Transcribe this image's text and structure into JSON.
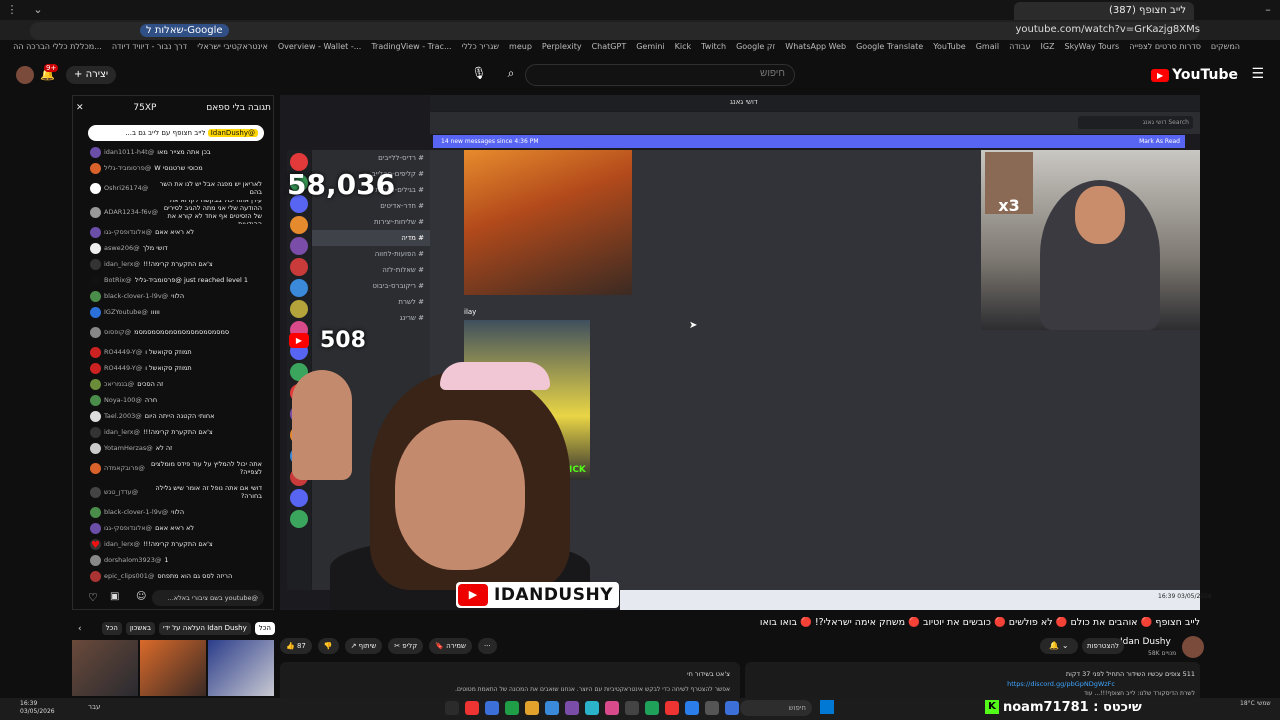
{
  "browser": {
    "active_tab_title": "לייב חצופף (387)",
    "url": "youtube.com/watch?v=GrKazjg8XMs",
    "google_button": "שאלות ל-Google",
    "bookmarks": [
      "המשקים",
      "סדרות סרטים לצפייה",
      "SkyWay Tours",
      "IGZ",
      "עבודה",
      "Gmail",
      "YouTube",
      "Google Translate",
      "WhatsApp Web",
      "Google זק",
      "Twitch",
      "Kick",
      "Gemini",
      "ChatGPT",
      "Perplexity",
      "meup",
      "שגריר כללי",
      "TradingView - Trac...",
      "Overview - Wallet -...",
      "אינטראקטיבי ישראלי",
      "דרך נבור - דיוויד דיודה",
      "מכללת כללי הברכה הה..."
    ]
  },
  "youtube": {
    "logo": "YouTube",
    "search_placeholder": "חיפוש",
    "create_label": "+ יצירה",
    "notif_count": "9+"
  },
  "chat": {
    "title": "תגובה בלי ספאם",
    "points": "75XP",
    "pinned_author": "@IdanDushy",
    "pinned_text": "לייב חצופף עם לייב גם ב...",
    "messages": [
      {
        "author": "@idan1011-h4t",
        "text": "בכן אתה מצייר מאו",
        "color": "#6b4ea8",
        "tall": false
      },
      {
        "author": "@פרסומביד-גליל",
        "text": "מכוסי שרטנוסי W",
        "color": "#d9622b",
        "tall": false
      },
      {
        "author": "@Oshri26174",
        "text": "לאריאן יש מפגה אבל יש לנו את השר בהם",
        "color": "#ffffff",
        "tall": true
      },
      {
        "author": "@ADAR1234-f6v",
        "text": "עידן אתה יכול בבקשה לקרוא את ההודעה שלי אני מתה להגיב לסירים של הזסיטים אף אחד לא קורא את ההודעות",
        "color": "#999999",
        "tall": true
      },
      {
        "author": "@אלונדופסקי-גגו",
        "text": "לא ראיא אאם",
        "color": "#6b4ea8",
        "tall": false
      },
      {
        "author": "@aswe206",
        "text": "דושי מלך",
        "color": "#eeeeee",
        "tall": false
      },
      {
        "author": "@idan_lerx",
        "text": "צ'אם התקערת קרימה!!!",
        "color": "#333333",
        "tall": false
      },
      {
        "author": "@BotRix",
        "text": "just reached level 1 @פרסומביד-גליל",
        "color": "#111111",
        "tall": false
      },
      {
        "author": "@black-clover-1-l9v",
        "text": "הלווי",
        "color": "#4a8d4a",
        "tall": false
      },
      {
        "author": "@IGZYoutube",
        "text": "ווווו",
        "color": "#2b6fd9",
        "tall": false
      },
      {
        "author": "@קופסוס",
        "text": "סמסמסמסמסמסמסמסמסמסמסמ",
        "color": "#888888",
        "tall": true
      },
      {
        "author": "@RO4449-Y",
        "text": "תמוזק סקואשל ו",
        "color": "#cc2222",
        "tall": false
      },
      {
        "author": "@RO4449-Y",
        "text": "תמוזק סקואשל ו",
        "color": "#cc2222",
        "tall": false
      },
      {
        "author": "@בנמריאכ",
        "text": "זה הסכים",
        "color": "#6b8d3a",
        "tall": false
      },
      {
        "author": "@Noya-100",
        "text": "חרה",
        "color": "#4a8d4a",
        "tall": false
      },
      {
        "author": "@Tael.2003",
        "text": "אחותי הקטנה הייתה היום",
        "color": "#dddddd",
        "tall": false
      },
      {
        "author": "@idan_lerx",
        "text": "צ'אם התקערת קרימה!!!",
        "color": "#333333",
        "tall": false
      },
      {
        "author": "@YotamHerzas",
        "text": "זה לא",
        "color": "#cccccc",
        "tall": false
      },
      {
        "author": "@פרובקאמדה",
        "text": "אתה יכול להמליץ על עוד פידס מומלצים לצפייה?",
        "color": "#d9622b",
        "tall": true
      },
      {
        "author": "@עדדן_טנש",
        "text": "דושי אם אתה נופל זה אומר שיש גלילה בחורה?",
        "color": "#444444",
        "tall": true
      },
      {
        "author": "@black-clover-1-l9v",
        "text": "הלווי",
        "color": "#4a8d4a",
        "tall": false
      },
      {
        "author": "@אלונדופסקי-גגו",
        "text": "לא ראיא אאם",
        "color": "#6b4ea8",
        "tall": false
      },
      {
        "author": "@idan_lerx",
        "text": "צ'אם התקערת קרימה!!!",
        "color": "#333333",
        "tall": false
      },
      {
        "author": "@dorshalom3923",
        "text": "1",
        "color": "#888888",
        "tall": false
      },
      {
        "author": "@epic_clips001",
        "text": "הריזה לסס גם הוא מתפחס",
        "color": "#aa3333",
        "tall": false
      },
      {
        "author": "@אלונדופסקי-גגו",
        "text": "לא ראיא אאם",
        "color": "#6b4ea8",
        "tall": false
      }
    ],
    "input_placeholder": "@youtube בשם ציבורי באלא...",
    "chips": [
      "הכל",
      "העלאה על ידי Idan Dushy",
      "באשכון",
      "הכל"
    ]
  },
  "video": {
    "discord_title": "דושי גאנג",
    "discord_search": "Search דושי גאנג",
    "new_messages_banner": "14 new messages since 4:36 PM",
    "mark_as_read": "Mark As Read",
    "channels": [
      "רדיס-ללייבים",
      "קליפים-מהלייב",
      "בגילים-וטוחות",
      "חדר-אדיטים",
      "שליחות-יצירות",
      "מדיה",
      "הפועות-לחווה",
      "שאלות-לזה",
      "ריקוברס-ביבוט",
      "לשרת",
      "שרינג"
    ],
    "selected_channel": "מדיה",
    "msg_author": "ilay",
    "viewer_count": "58,036",
    "yt_count": "508",
    "overlay_x3": "x3",
    "kick_label": "KICK",
    "channel_tag": "IDANDUSHY",
    "inner_clock": "16:39 03/05/2026"
  },
  "details": {
    "title": "לייב חצופף 🔴 אוהבים את כולם 🔴 לא פולשים 🔴 כובשים את יוטיוב 🔴 משחק אימה ישראלי?! 🔴 בואו בואו",
    "channel_name": "Idan Dushy",
    "channel_subs": "58K מנויים",
    "join_label": "להצטרפות",
    "sub_label": "🔔 ⌄",
    "actions": [
      "👍 87",
      "👎",
      "↗ שיתוף",
      "✂ קליפ",
      "🔖 שמירה",
      "···"
    ],
    "desc_left_title": "צ'אט בשידור חי",
    "desc_left_text": "אפשר להצטרף לשיחה כדי לבקש אינטראקטיביות עם היוצר. אנחנו שואבים את המכונה של התאמת מטוטים.",
    "desc_right_title": "511 צופים עכשיו  השידור התחיל לפני 37 דקות",
    "desc_right_link": "https://discord.gg/pbGpNDgWzFc",
    "desc_right_text": "לשרת הדיסקורד שלנו: לייב חצופף!!!... עוד"
  },
  "taskbar": {
    "time": "16:39",
    "date": "03/05/2026",
    "search": "חיפוש",
    "lang": "עבר",
    "kick_name": "noam71781 : שיכטס",
    "weather": "18°C שמשי"
  },
  "colors": {
    "yt_red": "#ff0000",
    "discord_blurple": "#5865f2",
    "kick_green": "#53fc18"
  }
}
